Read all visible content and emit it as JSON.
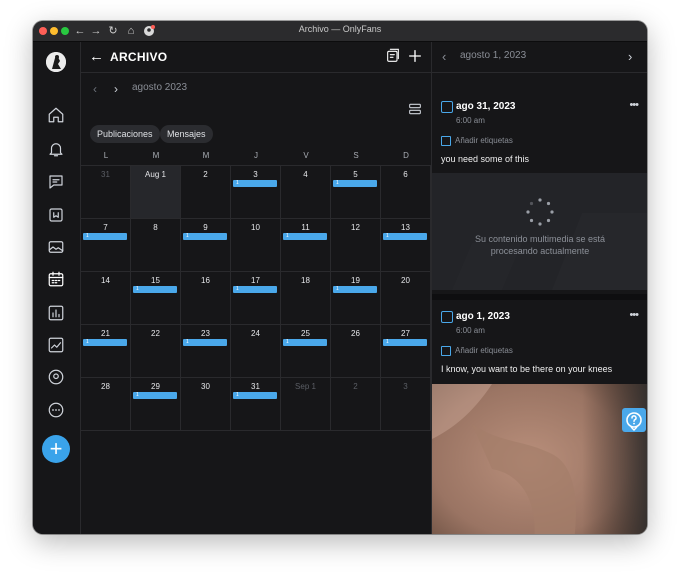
{
  "window": {
    "title": "Archivo — OnlyFans",
    "traffic_light_colors": [
      "#ff5f57",
      "#febc2e",
      "#28c840"
    ]
  },
  "sidebar": {
    "items": [
      {
        "name": "home",
        "icon": "home-icon"
      },
      {
        "name": "notifications",
        "icon": "bell-icon"
      },
      {
        "name": "messages",
        "icon": "message-icon"
      },
      {
        "name": "collections",
        "icon": "bookmark-icon"
      },
      {
        "name": "vault",
        "icon": "image-icon"
      },
      {
        "name": "queue",
        "icon": "calendar-icon",
        "active": true
      },
      {
        "name": "statistics",
        "icon": "bar-chart-icon"
      },
      {
        "name": "analytics",
        "icon": "trend-chart-icon"
      },
      {
        "name": "profile",
        "icon": "user-circle-icon"
      },
      {
        "name": "more",
        "icon": "more-icon"
      }
    ],
    "add_button": "+"
  },
  "main": {
    "title": "ARCHIVO",
    "month": "agosto 2023",
    "filters": [
      "Publicaciones",
      "Mensajes"
    ],
    "weekdays": [
      "L",
      "M",
      "M",
      "J",
      "V",
      "S",
      "D"
    ],
    "weeks": [
      [
        {
          "d": "31",
          "muted": true
        },
        {
          "d": "Aug 1",
          "today": true
        },
        {
          "d": "2"
        },
        {
          "d": "3",
          "c": "1"
        },
        {
          "d": "4"
        },
        {
          "d": "5",
          "c": "1"
        },
        {
          "d": "6"
        }
      ],
      [
        {
          "d": "7",
          "c": "1"
        },
        {
          "d": "8"
        },
        {
          "d": "9",
          "c": "1"
        },
        {
          "d": "10"
        },
        {
          "d": "11",
          "c": "1"
        },
        {
          "d": "12"
        },
        {
          "d": "13",
          "c": "1"
        }
      ],
      [
        {
          "d": "14"
        },
        {
          "d": "15",
          "c": "1"
        },
        {
          "d": "16"
        },
        {
          "d": "17",
          "c": "1"
        },
        {
          "d": "18"
        },
        {
          "d": "19",
          "c": "1"
        },
        {
          "d": "20"
        }
      ],
      [
        {
          "d": "21",
          "c": "1"
        },
        {
          "d": "22"
        },
        {
          "d": "23",
          "c": "1"
        },
        {
          "d": "24"
        },
        {
          "d": "25",
          "c": "1"
        },
        {
          "d": "26"
        },
        {
          "d": "27",
          "c": "1"
        }
      ],
      [
        {
          "d": "28"
        },
        {
          "d": "29",
          "c": "1"
        },
        {
          "d": "30"
        },
        {
          "d": "31",
          "c": "1"
        },
        {
          "d": "Sep 1",
          "muted": true
        },
        {
          "d": "2",
          "muted": true
        },
        {
          "d": "3",
          "muted": true
        }
      ]
    ]
  },
  "right_panel": {
    "month": "agosto 1, 2023",
    "posts": [
      {
        "date": "ago 31, 2023",
        "time": "6:00 am",
        "tags": "Añadir etiquetas",
        "text": "you need some of this",
        "media_status": "Su contenido multimedia se está procesando actualmente"
      },
      {
        "date": "ago 1, 2023",
        "time": "6:00 am",
        "tags": "Añadir etiquetas",
        "text": "I know, you want to be there on your knees"
      }
    ]
  },
  "accent_color": "#4aa8ea"
}
